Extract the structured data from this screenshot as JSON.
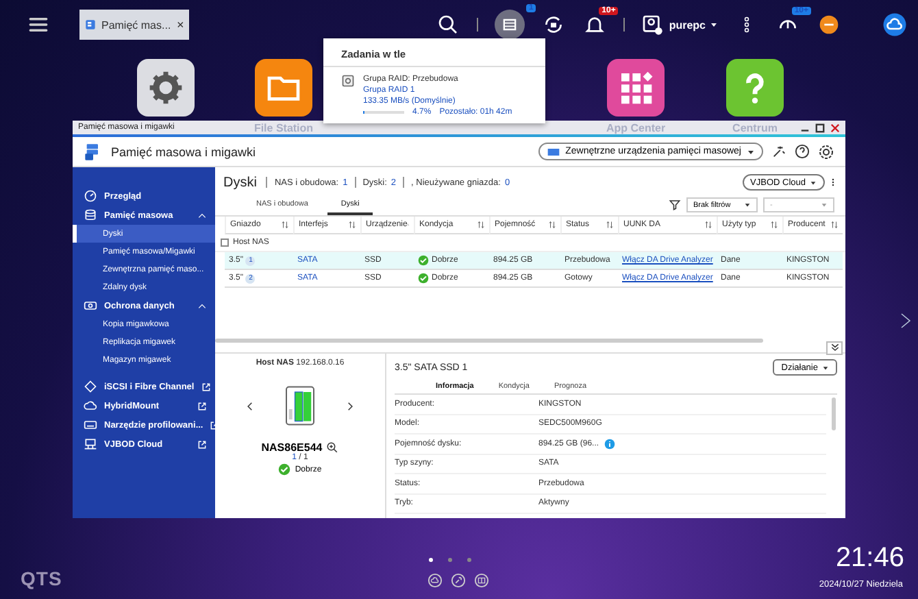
{
  "topbar": {
    "tab_label": "Pamięć mas...",
    "tasks_badge": "1",
    "alerts_badge": "10+",
    "user": "purepc",
    "info_badge": "10+"
  },
  "tasks_popup": {
    "title": "Zadania w tle",
    "name": "Grupa RAID: Przebudowa",
    "group": "Grupa RAID 1",
    "speed": "133.35 MB/s (Domyślnie)",
    "level": 0.047,
    "percent": "4.7%",
    "remaining": "Pozostało: 01h 42m"
  },
  "desktop_icons": [
    {
      "kind": "settings"
    },
    {
      "kind": "folder",
      "label": "File Station"
    },
    {
      "kind": "apps",
      "label": "App Center"
    },
    {
      "kind": "help",
      "label": "Centrum"
    }
  ],
  "window": {
    "title": "Pamięć masowa i migawki",
    "app_title": "Pamięć masowa i migawki",
    "external_button": "Zewnętrzne urządzenia pamięci masowej"
  },
  "sidebar": [
    {
      "label": "Przegląd",
      "selected": false
    },
    {
      "label": "Pamięć masowa",
      "expanded": true,
      "selected": false,
      "children": [
        {
          "label": "Dyski",
          "selected": true
        },
        {
          "label": "Pamięć masowa/Migawki",
          "selected": false
        },
        {
          "label": "Zewnętrzna pamięć maso...",
          "selected": false
        },
        {
          "label": "Zdalny dysk",
          "selected": false
        }
      ]
    },
    {
      "label": "Ochrona danych",
      "expanded": true,
      "selected": false,
      "children": [
        {
          "label": "Kopia migawkowa",
          "selected": false
        },
        {
          "label": "Replikacja migawek",
          "selected": false
        },
        {
          "label": "Magazyn migawek",
          "selected": false
        }
      ]
    },
    {
      "label": "iSCSI i Fibre Channel",
      "external": true,
      "selected": false
    },
    {
      "label": "HybridMount",
      "external": true,
      "selected": false
    },
    {
      "label": "Narzędzie profilowani...",
      "external": true,
      "selected": false
    },
    {
      "label": "VJBOD Cloud",
      "external": true,
      "selected": false
    }
  ],
  "page": {
    "title": "Dyski",
    "summary": [
      {
        "label": "NAS i obudowa:",
        "value": "1"
      },
      {
        "label": "Dyski:",
        "value": "2"
      },
      {
        "label": ", Nieużywane gniazda:",
        "value": "0"
      }
    ],
    "vjbod_button": "VJBOD Cloud"
  },
  "subtabs": [
    {
      "label": "NAS i obudowa",
      "selected": false
    },
    {
      "label": "Dyski",
      "selected": true
    }
  ],
  "filter": {
    "value": "Brak filtrów",
    "second": "-"
  },
  "table": {
    "columns": [
      "Gniazdo",
      "Interfejs",
      "Urządzenie",
      "Kondycja",
      "Pojemność",
      "Status",
      "UUNK DA",
      "Użyty typ",
      "Producent"
    ],
    "group": "Host NAS",
    "rows": [
      {
        "slot": "3.5\"",
        "slot_no": "1",
        "interface": "SATA",
        "device": "SSD",
        "health": "Dobrze",
        "capacity": "894.25 GB",
        "status": "Przebudowa",
        "link": "Włącz DA Drive Analyzer",
        "type": "Dane",
        "vendor": "KINGSTON",
        "selected": true
      },
      {
        "slot": "3.5\"",
        "slot_no": "2",
        "interface": "SATA",
        "device": "SSD",
        "health": "Dobrze",
        "capacity": "894.25 GB",
        "status": "Gotowy",
        "link": "Włącz DA Drive Analyzer",
        "type": "Dane",
        "vendor": "KINGSTON",
        "selected": false
      }
    ]
  },
  "detail": {
    "host_label": "Host NAS",
    "ip": "192.168.0.16",
    "nas_name": "NAS86E544",
    "page_current": "1",
    "page_total": "/ 1",
    "status": "Dobrze",
    "disk_title": "3.5\" SATA SSD 1",
    "action_button": "Działanie",
    "tabs": [
      {
        "label": "Informacja",
        "selected": true
      },
      {
        "label": "Kondycja",
        "selected": false
      },
      {
        "label": "Prognoza",
        "selected": false
      }
    ],
    "fields": [
      {
        "label": "Producent:",
        "value": "KINGSTON"
      },
      {
        "label": "Model:",
        "value": "SEDC500M960G"
      },
      {
        "label": "Pojemność dysku:",
        "value": "894.25 GB (96...",
        "info": true
      },
      {
        "label": "Typ szyny:",
        "value": "SATA"
      },
      {
        "label": "Status:",
        "value": "Przebudowa"
      },
      {
        "label": "Tryb:",
        "value": "Aktywny"
      }
    ]
  },
  "footer": {
    "logo": "QTS",
    "pages": [
      {
        "selected": true
      },
      {
        "selected": false
      },
      {
        "selected": false
      }
    ],
    "time": "21:46",
    "date": "2024/10/27 Niedziela"
  }
}
